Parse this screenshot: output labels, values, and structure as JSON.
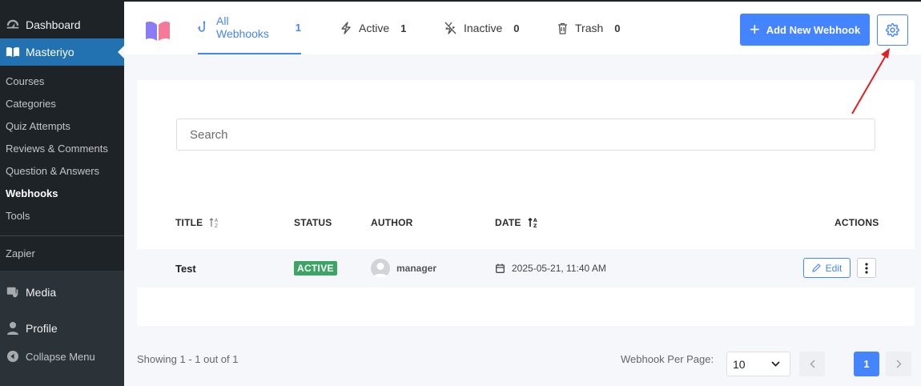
{
  "sidebar": {
    "dashboard": "Dashboard",
    "masteriyo": "Masteriyo",
    "submenu": [
      "Courses",
      "Categories",
      "Quiz Attempts",
      "Reviews & Comments",
      "Question & Answers",
      "Webhooks",
      "Tools"
    ],
    "current_submenu": "Webhooks",
    "zapier": "Zapier",
    "media": "Media",
    "profile": "Profile",
    "collapse": "Collapse Menu"
  },
  "tabs": [
    {
      "label": "All Webhooks",
      "count": "1",
      "icon": "hook-icon",
      "active": true
    },
    {
      "label": "Active",
      "count": "1",
      "icon": "bolt-icon",
      "active": false
    },
    {
      "label": "Inactive",
      "count": "0",
      "icon": "bolt-off-icon",
      "active": false
    },
    {
      "label": "Trash",
      "count": "0",
      "icon": "trash-icon",
      "active": false
    }
  ],
  "header": {
    "add_button": "Add New Webhook"
  },
  "search": {
    "placeholder": "Search"
  },
  "table": {
    "columns": [
      "TITLE",
      "STATUS",
      "AUTHOR",
      "DATE",
      "ACTIONS"
    ],
    "rows": [
      {
        "title": "Test",
        "status": "ACTIVE",
        "author": "manager",
        "date": "2025-05-21, 11:40 AM",
        "edit": "Edit"
      }
    ]
  },
  "footer": {
    "showing": "Showing 1 - 1 out of 1",
    "per_page_label": "Webhook Per Page:",
    "per_page_value": "10",
    "current_page": "1"
  },
  "colors": {
    "accent": "#4584ff",
    "sidebar_bg": "#1d2327",
    "sidebar_active": "#2271b1",
    "status_active": "#3ca464",
    "annotation_arrow": "#e02020"
  }
}
